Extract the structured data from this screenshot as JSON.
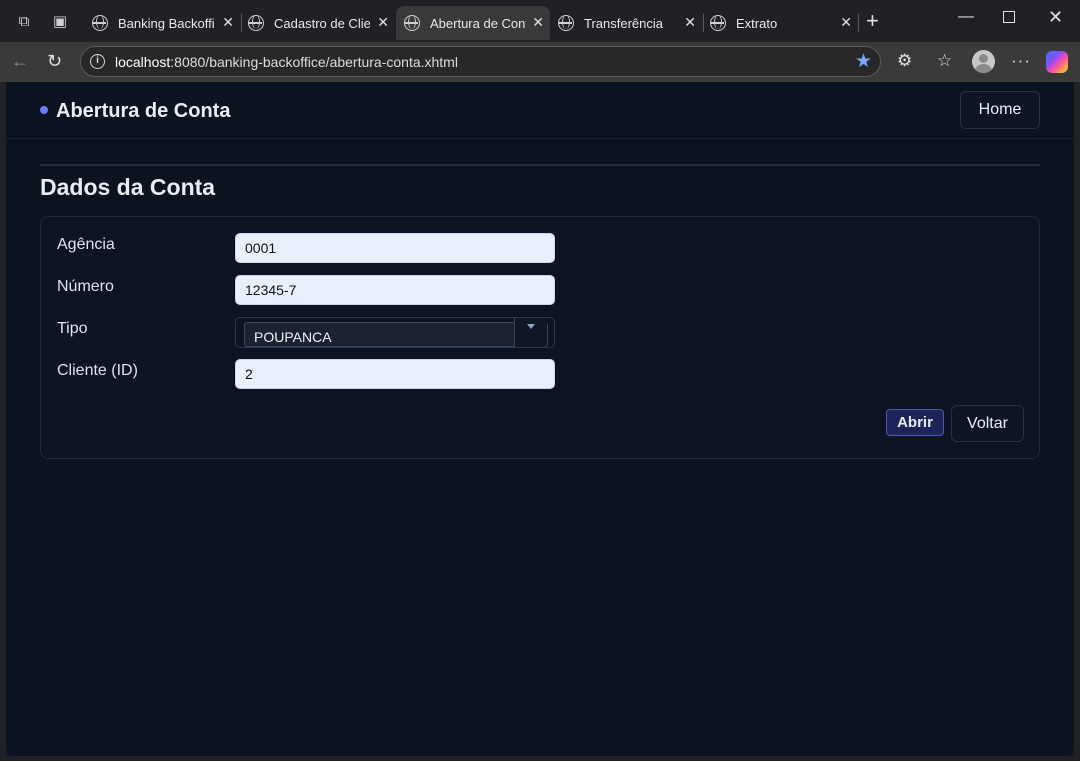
{
  "browser": {
    "tabs": [
      {
        "label": "Banking Backoffic",
        "active": false
      },
      {
        "label": "Cadastro de Clien",
        "active": false
      },
      {
        "label": "Abertura de Conta",
        "active": true
      },
      {
        "label": "Transferência",
        "active": false
      },
      {
        "label": "Extrato",
        "active": false
      }
    ],
    "url_host": "localhost",
    "url_rest": ":8080/banking-backoffice/abertura-conta.xhtml"
  },
  "header": {
    "title": "Abertura de Conta",
    "home_label": "Home"
  },
  "section": {
    "title": "Dados da Conta"
  },
  "form": {
    "agencia_label": "Agência",
    "agencia_value": "0001",
    "numero_label": "Número",
    "numero_value": "12345-7",
    "tipo_label": "Tipo",
    "tipo_value": "POUPANCA",
    "cliente_label": "Cliente (ID)",
    "cliente_value": "2",
    "abrir_label": "Abrir",
    "voltar_label": "Voltar"
  },
  "colors": {
    "page_bg": "#0b1220",
    "accent": "#6d7cff",
    "primary_button": "#1d2457",
    "input_bg": "#e8f0fe"
  }
}
